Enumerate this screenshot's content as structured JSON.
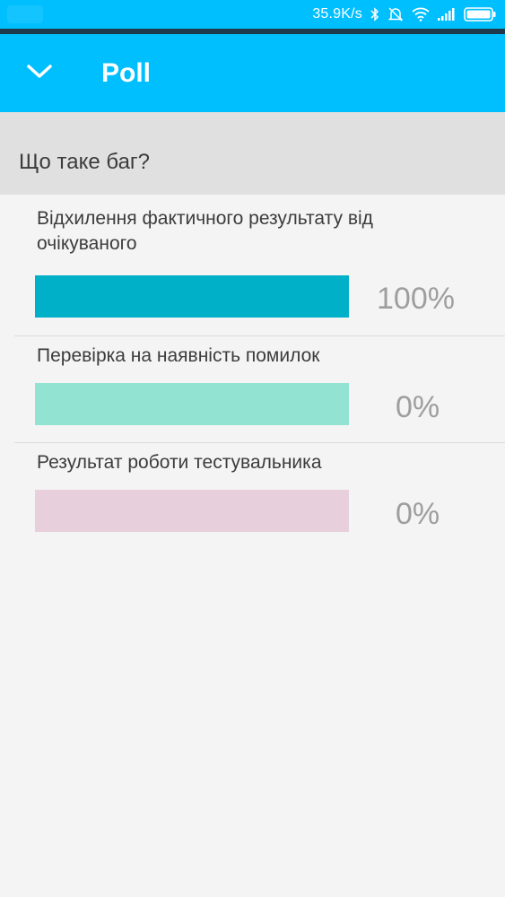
{
  "status_bar": {
    "net_speed": "35.9K/s",
    "icons": [
      "bluetooth-icon",
      "alarm-off-icon",
      "wifi-icon",
      "signal-icon",
      "battery-icon"
    ]
  },
  "app_bar": {
    "title": "Poll",
    "collapse_icon": "chevron-down-icon",
    "background": "#00bfff"
  },
  "poll": {
    "question": "Що таке баг?",
    "options": [
      {
        "label": "Відхилення фактичного результату від очікуваного",
        "percent_text": "100%",
        "fraction": 1.0,
        "color": "#00b0c8"
      },
      {
        "label": "Перевірка на наявність помилок",
        "percent_text": "0%",
        "fraction": 0.0,
        "color": "#92e3d1"
      },
      {
        "label": "Результат роботи тестувальника",
        "percent_text": "0%",
        "fraction": 0.0,
        "color": "#e8cfdc"
      }
    ]
  }
}
